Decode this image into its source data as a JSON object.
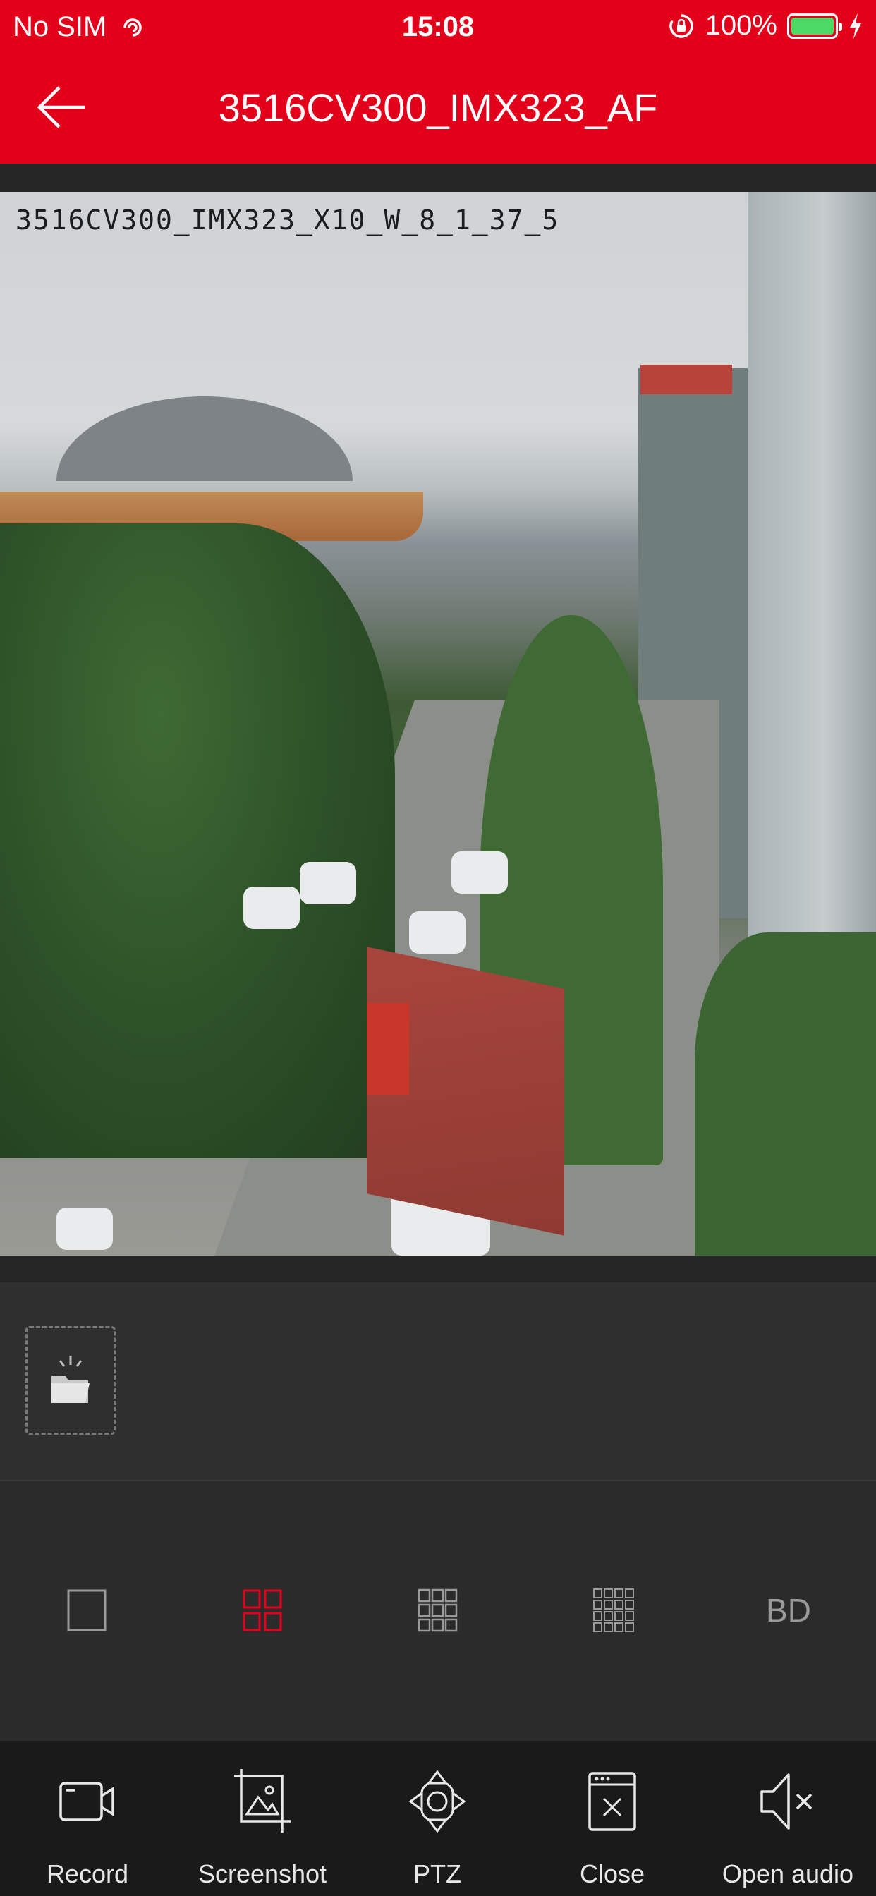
{
  "status_bar": {
    "carrier": "No SIM",
    "time": "15:08",
    "battery_percent": "100%"
  },
  "header": {
    "title": "3516CV300_IMX323_AF"
  },
  "video": {
    "osd_text": "3516CV300_IMX323_X10_W_8_1_37_5"
  },
  "layout_options": {
    "bd_label": "BD",
    "selected": "four-grid"
  },
  "toolbar": {
    "record_label": "Record",
    "screenshot_label": "Screenshot",
    "ptz_label": "PTZ",
    "close_label": "Close",
    "open_audio_label": "Open audio"
  },
  "colors": {
    "brand_red": "#e2001a",
    "battery_green": "#4cd964",
    "icon_gray": "#9a9a9a",
    "toolbar_bg": "#1a1a1a"
  }
}
